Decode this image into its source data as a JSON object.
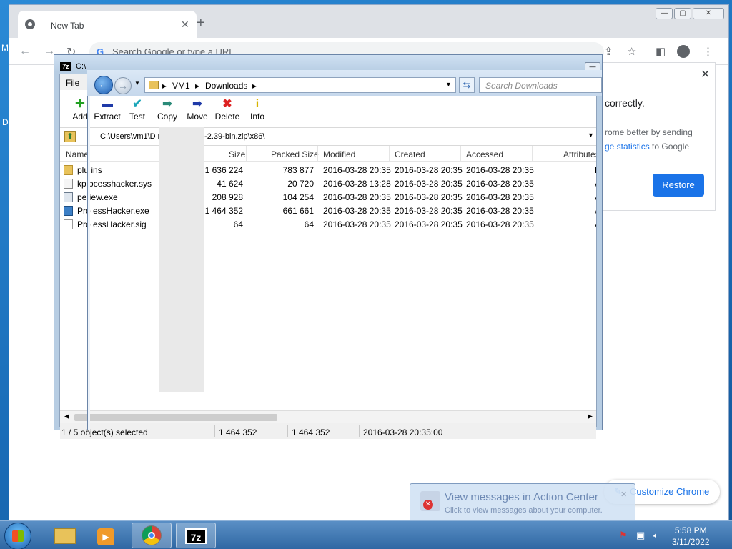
{
  "desktop": {
    "edge_left_top": "M",
    "edge_left_mid": "D"
  },
  "chrome": {
    "tab_title": "New Tab",
    "omnibox_placeholder": "Search Google or type a URL",
    "popup": {
      "line1": "correctly.",
      "line2": "rome better by sending",
      "line3_link": "ge statistics",
      "line3_rest": " to Google",
      "restore_label": "Restore"
    },
    "customize_label": "Customize Chrome"
  },
  "zip": {
    "title": "C:\\",
    "menu_file": "File",
    "toolbar": [
      "Add",
      "Extract",
      "Test",
      "Copy",
      "Move",
      "Delete",
      "Info"
    ],
    "path": "C:\\Users\\vm1\\D                        rocesshacker-2.39-bin.zip\\x86\\",
    "columns": [
      "Name",
      "Size",
      "Packed Size",
      "Modified",
      "Created",
      "Accessed",
      "Attributes"
    ],
    "rows": [
      {
        "name": "plu    ins",
        "size": "1 636 224",
        "packed": "783 877",
        "modified": "2016-03-28 20:35",
        "created": "2016-03-28 20:35",
        "accessed": "2016-03-28 20:35",
        "attr": "D",
        "type": "folder"
      },
      {
        "name": "kp    ocesshacker.sys",
        "size": "41 624",
        "packed": "20 720",
        "modified": "2016-03-28 13:28",
        "created": "2016-03-28 20:35",
        "accessed": "2016-03-28 20:35",
        "attr": "A",
        "type": "sys"
      },
      {
        "name": "pe    iew.exe",
        "size": "208 928",
        "packed": "104 254",
        "modified": "2016-03-28 20:35",
        "created": "2016-03-28 20:35",
        "accessed": "2016-03-28 20:35",
        "attr": "A",
        "type": "exe"
      },
      {
        "name": "Pro    essHacker.exe",
        "size": "1 464 352",
        "packed": "661 661",
        "modified": "2016-03-28 20:35",
        "created": "2016-03-28 20:35",
        "accessed": "2016-03-28 20:35",
        "attr": "A",
        "type": "exe2"
      },
      {
        "name": "Pro    essHacker.sig",
        "size": "64",
        "packed": "64",
        "modified": "2016-03-28 20:35",
        "created": "2016-03-28 20:35",
        "accessed": "2016-03-28 20:35",
        "attr": "A",
        "type": "file"
      }
    ],
    "status": {
      "selected": "1 / 5 object(s) selected",
      "size": "1 464 352",
      "packed": "1 464 352",
      "date": "2016-03-28 20:35:00"
    }
  },
  "explorer": {
    "crumb1": "VM1",
    "crumb2": "Downloads",
    "search_placeholder": "Search Downloads"
  },
  "balloon": {
    "title": "View messages in Action Center",
    "subtitle": "Click to view messages about your computer."
  },
  "clock": {
    "time": "5:58 PM",
    "date": "3/11/2022"
  }
}
